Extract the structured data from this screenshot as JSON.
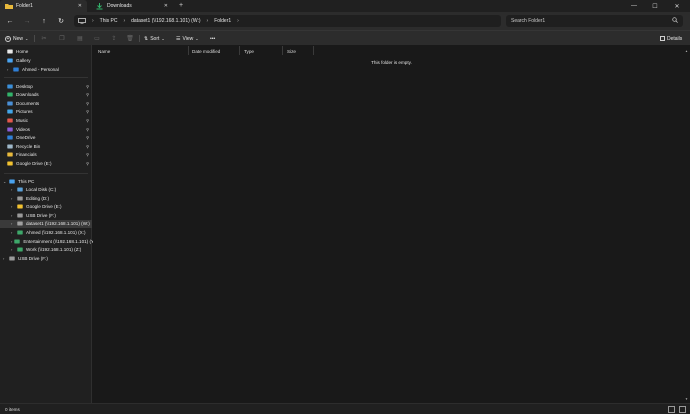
{
  "tabs": [
    {
      "label": "Folder1",
      "icon": "folder-icon"
    },
    {
      "label": "Downloads",
      "icon": "download-icon"
    }
  ],
  "window_controls": {
    "minimize": "—",
    "maximize": "☐",
    "close": "✕"
  },
  "nav": {
    "back": "←",
    "forward": "→",
    "up": "↑",
    "refresh": "↻"
  },
  "breadcrumb": [
    "This PC",
    "dataset1 (\\\\192.168.1.101) (W:)",
    "Folder1"
  ],
  "search": {
    "placeholder": "Search Folder1"
  },
  "toolbar": {
    "new_label": "New",
    "sort_label": "Sort",
    "view_label": "View",
    "more_label": "•••",
    "details_label": "Details"
  },
  "sidebar": {
    "top": [
      {
        "label": "Home",
        "icon": "home-icon",
        "color": "#e8e8e8"
      },
      {
        "label": "Gallery",
        "icon": "gallery-icon",
        "color": "#4aa3f0"
      },
      {
        "label": "Ahmed - Personal",
        "icon": "cloud-icon",
        "color": "#2f7fd6"
      }
    ],
    "quick": [
      {
        "label": "Desktop",
        "icon": "desktop-icon",
        "color": "#3b8fd9",
        "pinned": true
      },
      {
        "label": "Downloads",
        "icon": "download-icon",
        "color": "#32b36a",
        "pinned": true
      },
      {
        "label": "Documents",
        "icon": "documents-icon",
        "color": "#4a8fd6",
        "pinned": true
      },
      {
        "label": "Pictures",
        "icon": "pictures-icon",
        "color": "#42a5e8",
        "pinned": true
      },
      {
        "label": "Music",
        "icon": "music-icon",
        "color": "#e2574c",
        "pinned": true
      },
      {
        "label": "Videos",
        "icon": "videos-icon",
        "color": "#8a5cd6",
        "pinned": true
      },
      {
        "label": "OneDrive",
        "icon": "onedrive-icon",
        "color": "#2f7fd6",
        "pinned": true
      },
      {
        "label": "Recycle Bin",
        "icon": "recycle-bin-icon",
        "color": "#9fb8c9",
        "pinned": true
      },
      {
        "label": "Financials",
        "icon": "folder-icon",
        "color": "#e8b93c",
        "pinned": true
      },
      {
        "label": "Google Drive (E:)",
        "icon": "google-drive-icon",
        "color": "#f2c230",
        "pinned": true
      }
    ],
    "this_pc": {
      "label": "This PC",
      "icon": "this-pc-icon",
      "color": "#4aa3f0"
    },
    "drives": [
      {
        "label": "Local Disk (C:)",
        "icon": "local-disk-icon",
        "color": "#5aa0d8",
        "selected": false
      },
      {
        "label": "Editing (D:)",
        "icon": "drive-icon",
        "color": "#9a9a9a",
        "selected": false
      },
      {
        "label": "Google Drive (E:)",
        "icon": "google-drive-icon",
        "color": "#f2c230",
        "selected": false
      },
      {
        "label": "USB Drive (F:)",
        "icon": "usb-drive-icon",
        "color": "#9a9a9a",
        "selected": false
      },
      {
        "label": "dataset1 (\\\\192.168.1.101) (W:)",
        "icon": "network-drive-icon",
        "color": "#a0a0a0",
        "selected": true
      },
      {
        "label": "Ahmed (\\\\192.168.1.101) (X:)",
        "icon": "network-drive-icon",
        "color": "#3ea86a",
        "selected": false
      },
      {
        "label": "Entertainment (\\\\192.168.1.101) (Y:)",
        "icon": "network-drive-icon",
        "color": "#3ea86a",
        "selected": false
      },
      {
        "label": "Work (\\\\192.168.1.101) (Z:)",
        "icon": "network-drive-icon",
        "color": "#3ea86a",
        "selected": false
      }
    ],
    "usb": {
      "label": "USB Drive (F:)",
      "icon": "usb-drive-icon",
      "color": "#9a9a9a"
    }
  },
  "columns": [
    "Name",
    "Date modified",
    "Type",
    "Size"
  ],
  "empty_message": "This folder is empty.",
  "status": {
    "item_count": "0 items"
  }
}
